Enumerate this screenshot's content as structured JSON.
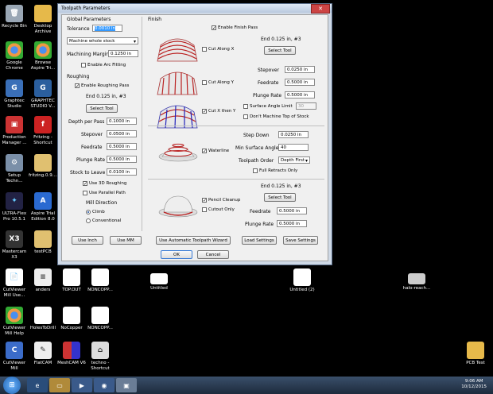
{
  "dialog": {
    "title": "Toolpath Parameters",
    "global": {
      "heading": "Global Parameters",
      "tolerance_label": "Tolerance",
      "tolerance_value": "0.0010 in",
      "stock_select": "Machine whole stock",
      "margin_label": "Machining Margin",
      "margin_value": "0.1250 in",
      "arc_fitting": "Enable Arc Fitting"
    },
    "roughing": {
      "heading": "Roughing",
      "enable_label": "Enable Roughing Pass",
      "tool_info": "End 0.125 in, #3",
      "select_tool": "Select Tool",
      "depth_label": "Depth per Pass",
      "depth_value": "0.1000 in",
      "stepover_label": "Stepover",
      "stepover_value": "0.0500 in",
      "feedrate_label": "Feedrate",
      "feedrate_value": "0.5000 in",
      "plunge_label": "Plunge Rate",
      "plunge_value": "0.5000 in",
      "stock_leave_label": "Stock to Leave",
      "stock_leave_value": "0.0100 in",
      "use3d": "Use 3D Roughing",
      "parallel": "Use Parallel Path",
      "mill_dir": "Mill Direction",
      "climb": "Climb",
      "conventional": "Conventional"
    },
    "finish": {
      "heading": "Finish",
      "enable_label": "Enable Finish Pass",
      "tool_info": "End 0.125 in, #3",
      "select_tool": "Select Tool",
      "cut_along_x": "Cut Along X",
      "cut_along_y": "Cut Along Y",
      "cut_x_then_y": "Cut X then Y",
      "stepover_label": "Stepover",
      "stepover_value": "0.0250 in",
      "feedrate_label": "Feedrate",
      "feedrate_value": "0.5000 in",
      "plunge_label": "Plunge Rate",
      "plunge_value": "0.5000 in",
      "surface_angle_limit": "Surface Angle Limit",
      "surface_angle_value": "30",
      "dont_machine_top": "Don't Machine Top of Stock"
    },
    "waterline": {
      "label": "Waterline",
      "stepdown_label": "Step Down",
      "stepdown_value": "0.0250 in",
      "min_angle_label": "Min Surface Angle",
      "min_angle_value": "40",
      "order_label": "Toolpath Order",
      "order_value": "Depth First",
      "full_retracts": "Full Retracts Only"
    },
    "pencil": {
      "label": "Pencil Cleanup",
      "cutout_only": "Cutout Only",
      "tool_info": "End 0.125 in, #3",
      "select_tool": "Select Tool",
      "feedrate_label": "Feedrate",
      "feedrate_value": "0.5000 in",
      "plunge_label": "Plunge Rate",
      "plunge_value": "0.5000 in"
    },
    "buttons": {
      "use_inch": "Use Inch",
      "use_mm": "Use MM",
      "auto_toolpath": "Use Automatic Toolpath Wizard",
      "load": "Load Settings",
      "save": "Save Settings",
      "ok": "OK",
      "cancel": "Cancel"
    }
  },
  "desktop_icons": {
    "recycle": "Recycle Bin",
    "archive": "Desktop Archive",
    "chrome": "Google Chrome",
    "aspire_browse": "Browse Aspire Tri...",
    "graphtec": "Graphtec Studio",
    "graphtec2": "GRAPHTEC STUDIO V...",
    "production": "Production Manager ...",
    "fritzing_sc": "Fritzing - Shortcut",
    "setup": "Setup Techn...",
    "fritzing": "fritzing.0.9....",
    "ultraflex": "ULTRA-Flex Pro 10.5.1",
    "aspire_trial": "Aspire Trial Edition 8.0",
    "mastercam": "Mastercam X3",
    "testpcb": "testPCB",
    "cutviewer_use": "CutViewer Mill Use...",
    "anders": "anders",
    "topout": "TOP.OUT",
    "noncopp1": "NONCOPP...",
    "untitled": "Untitled",
    "untitled2": "Untitled (2)",
    "halo": "halo-reach...",
    "cutviewer_help": "CutViewer Mill Help",
    "holes": "HolesToDrill",
    "nocopper": "NoCopper",
    "noncopp2": "NONCOPP...",
    "cutviewer_mill": "CutViewer Mill",
    "flatcam": "FlatCAM",
    "meshcam": "MeshCAM V6",
    "techno": "techno - Shortcut",
    "pcbtest": "PCB Test"
  },
  "taskbar": {
    "time": "9:06 AM",
    "date": "10/12/2015"
  }
}
